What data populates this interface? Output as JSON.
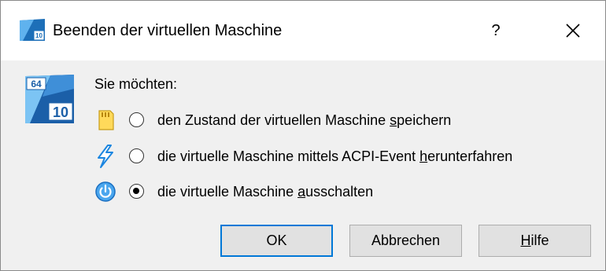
{
  "window": {
    "title": "Beenden der virtuellen Maschine",
    "help_label": "?",
    "close_icon": "close-icon"
  },
  "vm_icon": {
    "top_badge": "64",
    "bottom_badge": "10"
  },
  "prompt": {
    "label": "Sie möchten:"
  },
  "options": [
    {
      "icon": "sd-card-icon",
      "label_before": "den Zustand der virtuellen Maschine ",
      "mnemonic": "s",
      "label_after": "peichern",
      "selected": false
    },
    {
      "icon": "lightning-icon",
      "label_before": "die virtuelle Maschine mittels ACPI-Event ",
      "mnemonic": "h",
      "label_after": "erunterfahren",
      "selected": false
    },
    {
      "icon": "power-icon",
      "label_before": "die virtuelle Maschine ",
      "mnemonic": "a",
      "label_after": "usschalten",
      "selected": true
    }
  ],
  "buttons": {
    "ok": "OK",
    "cancel": "Abbrechen",
    "help_mnemonic": "H",
    "help_rest": "ilfe"
  },
  "colors": {
    "accent": "#0078d7",
    "button_face": "#e1e1e1",
    "dialog_bg": "#f0f0f0"
  }
}
